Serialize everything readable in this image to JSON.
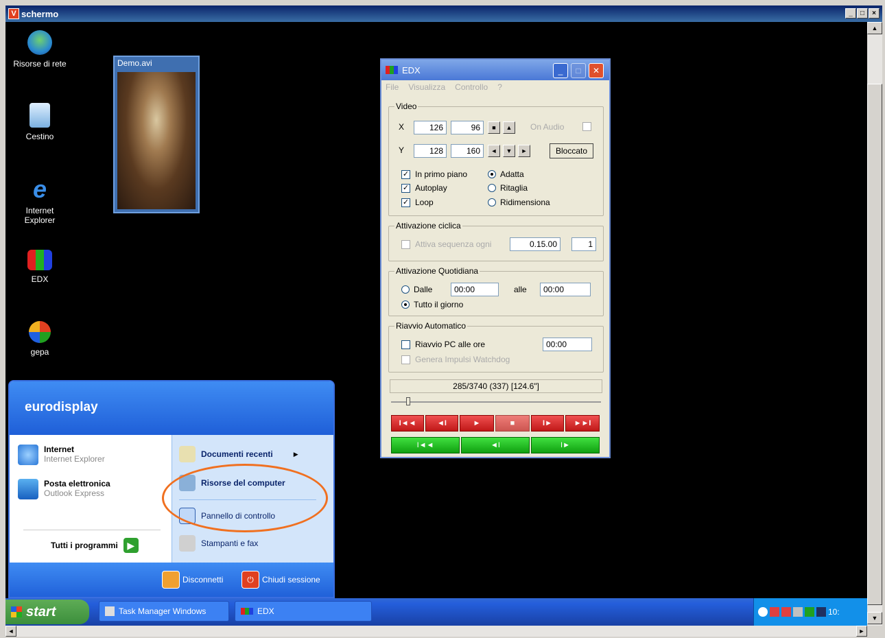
{
  "window": {
    "title": "schermo",
    "logo": "V"
  },
  "desktop": {
    "icons": [
      {
        "label": "Risorse di rete",
        "icon": "network-icon"
      },
      {
        "label": "Cestino",
        "icon": "recycle-bin-icon"
      },
      {
        "label": "Internet\nExplorer",
        "icon": "ie-icon"
      },
      {
        "label": "EDX",
        "icon": "edx-icon"
      },
      {
        "label": "gepa",
        "icon": "msn-icon"
      }
    ],
    "demo_window": {
      "title": "Demo.avi"
    }
  },
  "edx": {
    "title": "EDX",
    "menu": [
      "File",
      "Visualizza",
      "Controllo",
      "?"
    ],
    "video": {
      "label": "Video",
      "x_label": "X",
      "x1": "126",
      "x2": "96",
      "y_label": "Y",
      "y1": "128",
      "y2": "160",
      "on_audio": "On Audio",
      "bloccato": "Bloccato",
      "in_primo_piano": "In primo piano",
      "autoplay": "Autoplay",
      "loop": "Loop",
      "adatta": "Adatta",
      "ritaglia": "Ritaglia",
      "ridimensiona": "Ridimensiona"
    },
    "ciclica": {
      "label": "Attivazione ciclica",
      "text": "Attiva sequenza ogni",
      "time": "0.15.00",
      "count": "1"
    },
    "quotidiana": {
      "label": "Attivazione Quotidiana",
      "dalle": "Dalle",
      "from": "00:00",
      "alle": "alle",
      "to": "00:00",
      "tutto": "Tutto il giorno"
    },
    "riavvio": {
      "label": "Riavvio Automatico",
      "riavvio_pc": "Riavvio PC alle ore",
      "time": "00:00",
      "watchdog": "Genera Impulsi Watchdog"
    },
    "status": "285/3740 (337) [124.6\"]",
    "player_red": [
      "I◄◄",
      "◄I",
      "►",
      "■",
      "I►",
      "►►I"
    ],
    "player_green": [
      "I◄◄",
      "◄I",
      "I►"
    ]
  },
  "start_menu": {
    "user": "eurodisplay",
    "left": [
      {
        "title": "Internet",
        "sub": "Internet Explorer"
      },
      {
        "title": "Posta elettronica",
        "sub": "Outlook Express"
      }
    ],
    "all_programs": "Tutti i programmi",
    "right": [
      "Documenti recenti",
      "Risorse del computer",
      "Pannello di controllo",
      "Stampanti e fax"
    ],
    "disconnetti": "Disconnetti",
    "chiudi": "Chiudi sessione"
  },
  "taskbar": {
    "start": "start",
    "tasks": [
      "Task Manager Windows",
      "EDX"
    ],
    "clock": "10:"
  },
  "colors": {
    "highlight": "#f07020",
    "xp_blue": "#245edb"
  }
}
